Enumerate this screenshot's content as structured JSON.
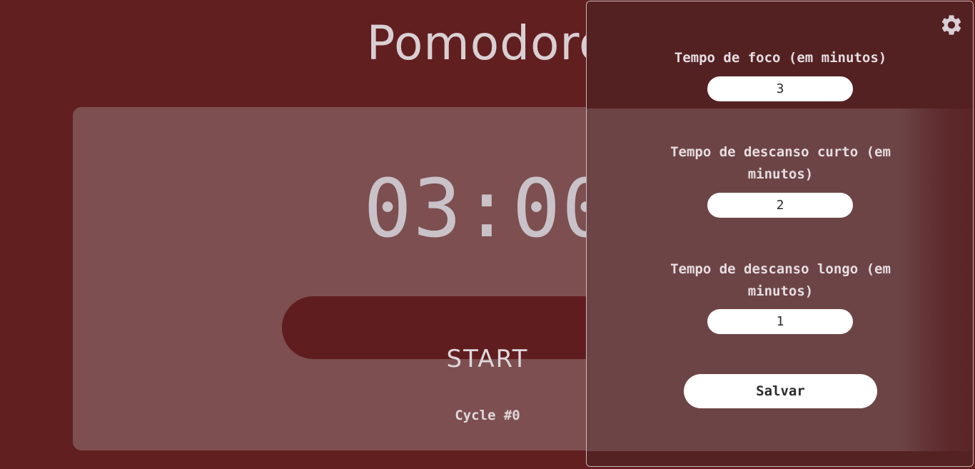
{
  "app": {
    "title": "Pomodoro"
  },
  "timer": {
    "display": "03:00",
    "start_label": "START",
    "cycle_label": "Cycle #0"
  },
  "settings": {
    "icon": "gear-icon",
    "focus": {
      "label": "Tempo de foco (em minutos)",
      "value": "3"
    },
    "short_break": {
      "label": "Tempo de descanso curto (em minutos)",
      "value": "2"
    },
    "long_break": {
      "label": "Tempo de descanso longo (em minutos)",
      "value": "1"
    },
    "save_label": "Salvar"
  },
  "colors": {
    "background": "#621f20",
    "card": "#7d4f50",
    "button": "#601d1f",
    "text": "#d9cfd3"
  }
}
